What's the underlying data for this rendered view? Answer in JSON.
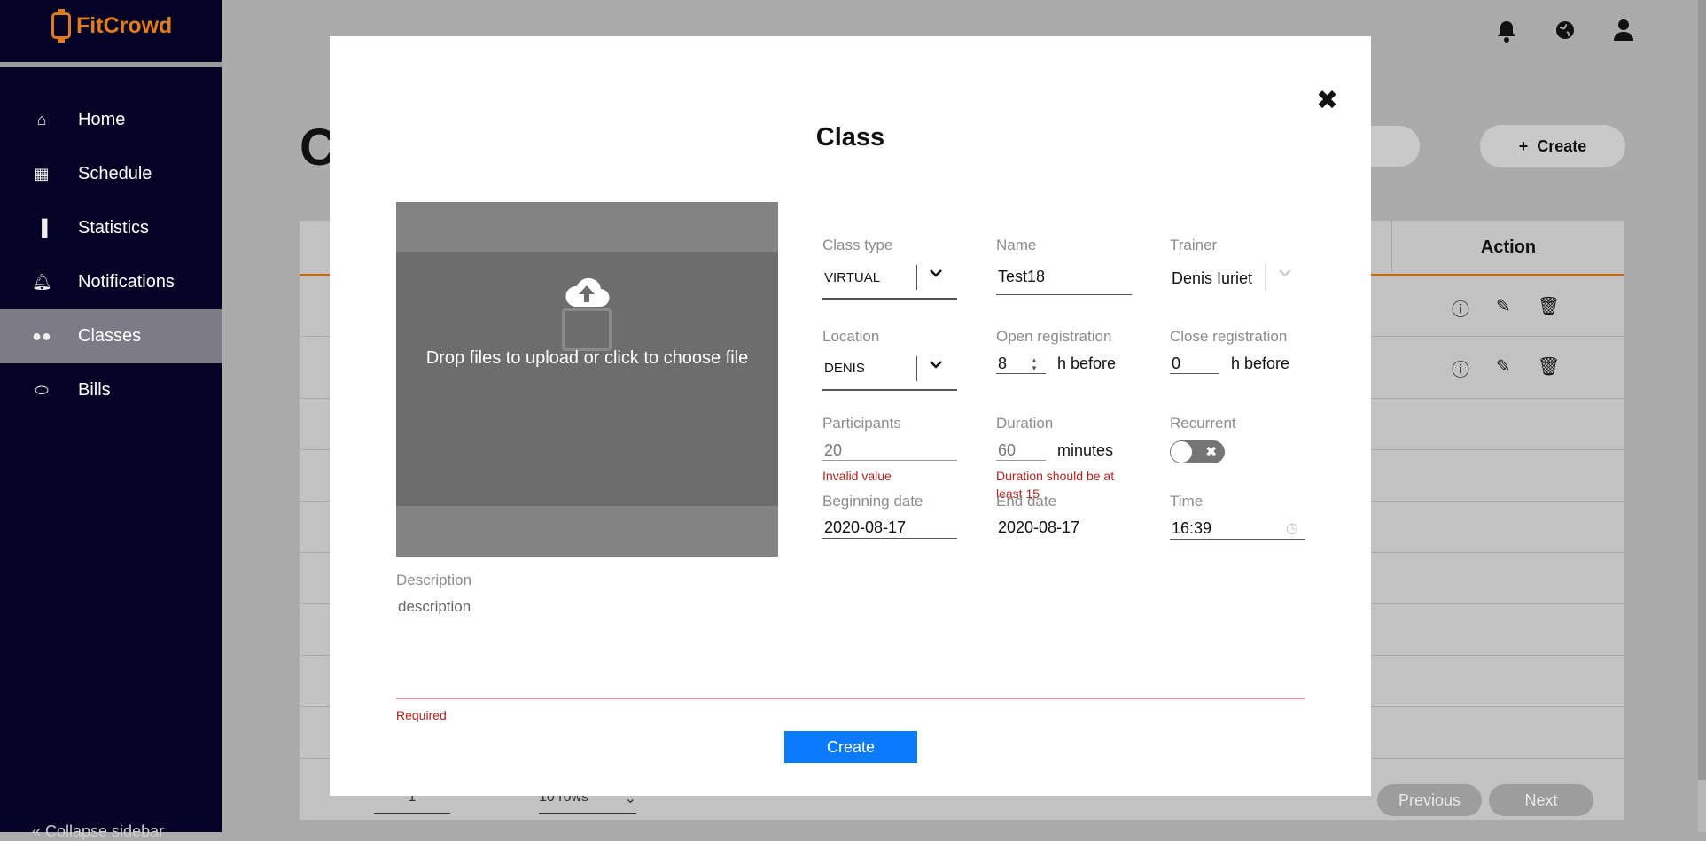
{
  "app": {
    "name": "FitCrowd"
  },
  "sidebar": {
    "items": [
      {
        "label": "Home",
        "icon": "home-icon"
      },
      {
        "label": "Schedule",
        "icon": "calendar-icon"
      },
      {
        "label": "Statistics",
        "icon": "bar-chart-icon"
      },
      {
        "label": "Notifications",
        "icon": "bell-icon"
      },
      {
        "label": "Classes",
        "icon": "users-icon",
        "active": true
      },
      {
        "label": "Bills",
        "icon": "pill-icon"
      }
    ],
    "bottom_label": "« Collapse sidebar"
  },
  "header": {
    "icons": [
      "bell-icon",
      "globe-icon",
      "user-icon"
    ]
  },
  "background_page": {
    "title": "C",
    "create_label": "Create",
    "table_action_header": "Action",
    "pager": {
      "page": "1",
      "rows": "10 rows",
      "previous": "Previous",
      "next": "Next"
    }
  },
  "modal": {
    "title": "Class",
    "dropzone_text": "Drop files to upload or click to choose file",
    "fields": {
      "class_type": {
        "label": "Class type",
        "value": "VIRTUAL"
      },
      "name": {
        "label": "Name",
        "value": "Test18"
      },
      "trainer": {
        "label": "Trainer",
        "value": "Denis Iuriet"
      },
      "location": {
        "label": "Location",
        "value": "DENIS"
      },
      "open_registration": {
        "label": "Open registration",
        "value": "8",
        "suffix": "h before"
      },
      "close_registration": {
        "label": "Close registration",
        "value": "0",
        "suffix": "h before"
      },
      "participants": {
        "label": "Participants",
        "value": "20",
        "error": "Invalid value"
      },
      "duration": {
        "label": "Duration",
        "value": "60",
        "suffix": "minutes",
        "error": "Duration should be at least 15"
      },
      "recurrent": {
        "label": "Recurrent",
        "checked": false
      },
      "beginning_date": {
        "label": "Beginning date",
        "value": "2020-08-17"
      },
      "end_date": {
        "label": "End date",
        "value": "2020-08-17"
      },
      "time": {
        "label": "Time",
        "value": "16:39"
      },
      "description": {
        "label": "Description",
        "placeholder": "description",
        "error": "Required"
      }
    },
    "create_label": "Create"
  }
}
